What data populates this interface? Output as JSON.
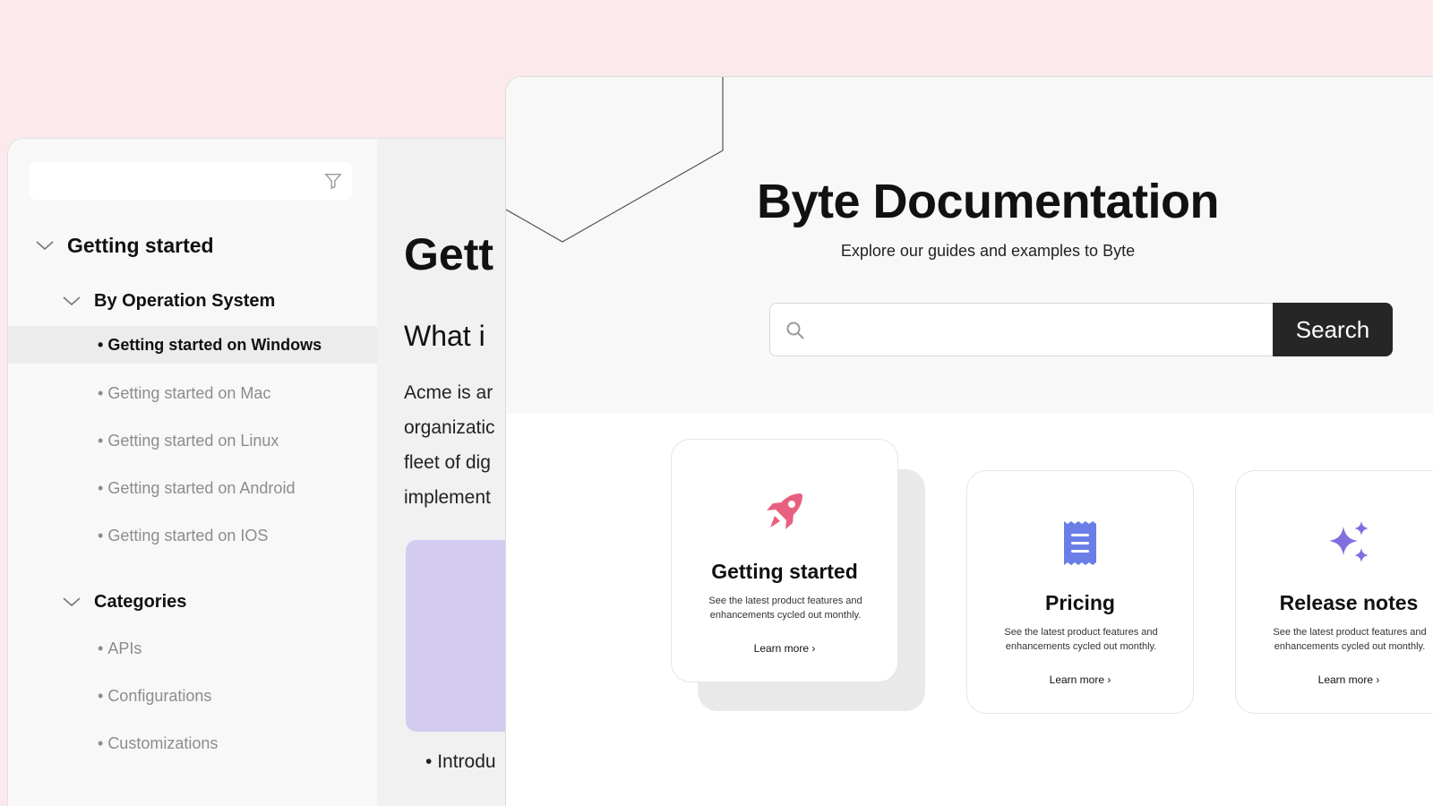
{
  "sidebar": {
    "sections": [
      {
        "label": "Getting started"
      },
      {
        "label": "By Operation System"
      },
      {
        "label": "Getting started on Windows"
      },
      {
        "label": "Getting started on Mac"
      },
      {
        "label": "Getting started on Linux"
      },
      {
        "label": "Getting started on Android"
      },
      {
        "label": "Getting started on IOS"
      },
      {
        "label": "Categories"
      },
      {
        "label": "APIs"
      },
      {
        "label": "Configurations"
      },
      {
        "label": "Customizations"
      }
    ]
  },
  "doc": {
    "title": "Gett",
    "subtitle": "What i",
    "lines": [
      "Acme is ar",
      "organizatic",
      "fleet of dig",
      "implement"
    ],
    "bullet": "Introdu"
  },
  "hero": {
    "title": "Byte Documentation",
    "subtitle": "Explore our guides and examples to Byte",
    "search_placeholder": "",
    "search_button": "Search"
  },
  "cards": [
    {
      "icon": "rocket-icon",
      "title": "Getting started",
      "desc": "See the latest product features and enhancements cycled out monthly.",
      "link": "Learn more"
    },
    {
      "icon": "receipt-icon",
      "title": "Pricing",
      "desc": "See the latest product features and enhancements cycled out monthly.",
      "link": "Learn more"
    },
    {
      "icon": "sparkles-icon",
      "title": "Release notes",
      "desc": "See the latest product features and enhancements cycled out monthly.",
      "link": "Learn more"
    }
  ],
  "colors": {
    "background": "#fbe9ec",
    "rocket": "#e8607f",
    "receipt": "#6a7ee8",
    "sparkles": "#7f6fe0",
    "button": "#262626"
  }
}
